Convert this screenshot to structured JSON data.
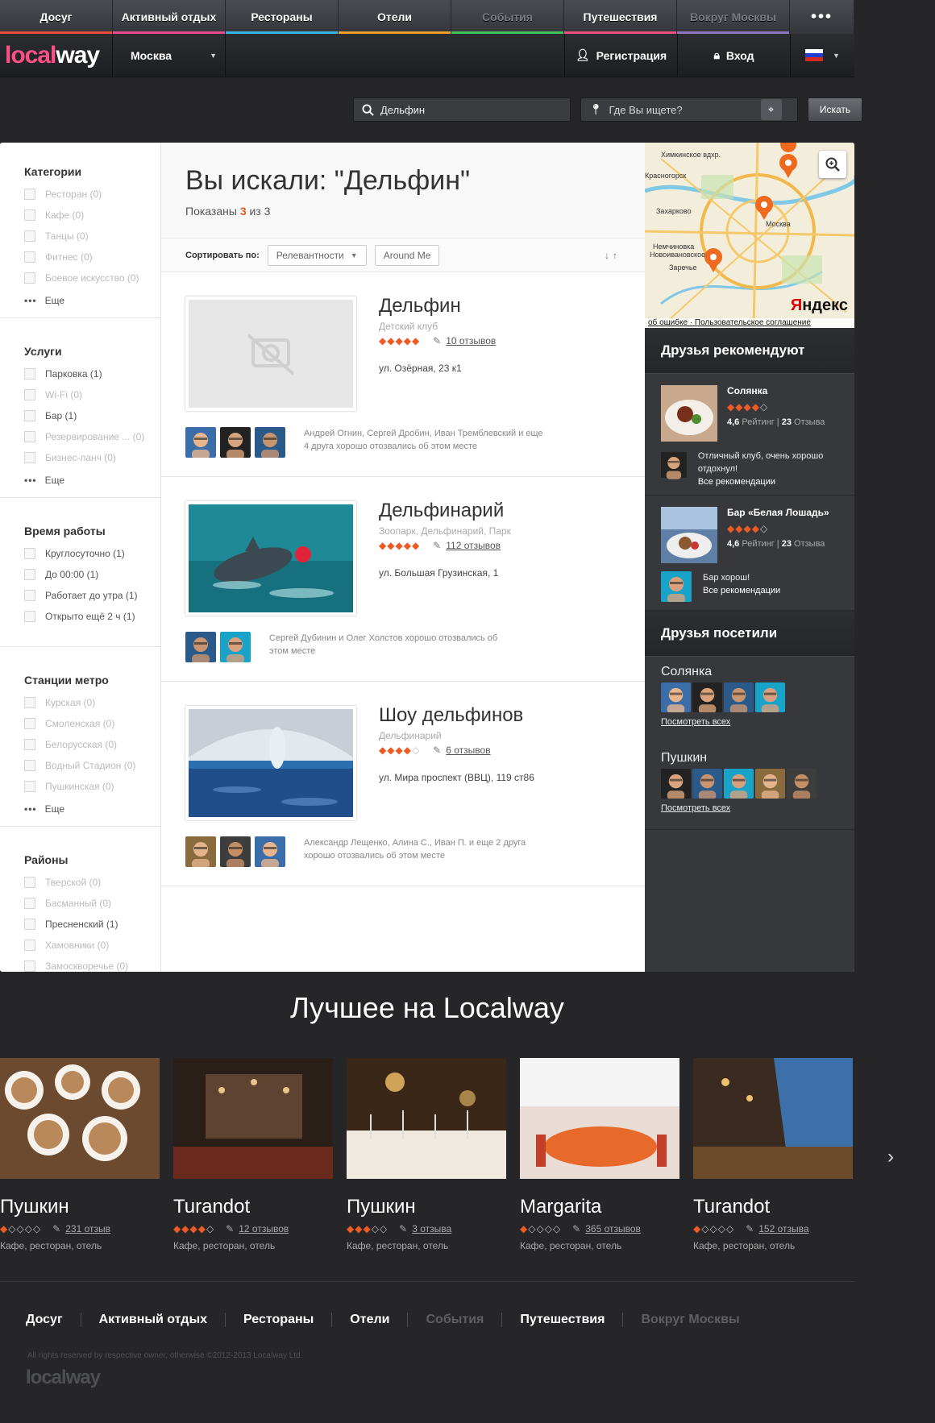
{
  "top_nav": [
    {
      "label": "Досуг",
      "color": "#e94b3c",
      "dim": false
    },
    {
      "label": "Активный отдых",
      "color": "#e84a8b",
      "dim": false
    },
    {
      "label": "Рестораны",
      "color": "#35b6e5",
      "dim": false
    },
    {
      "label": "Отели",
      "color": "#f2a02c",
      "dim": false
    },
    {
      "label": "События",
      "color": "#3cc35a",
      "dim": true
    },
    {
      "label": "Путешествия",
      "color": "#ef4f7f",
      "dim": false
    },
    {
      "label": "Вокруг Москвы",
      "color": "#8f74c4",
      "dim": true
    }
  ],
  "top_more": "•••",
  "logo": {
    "part1": "local",
    "part2": "way"
  },
  "city": "Москва",
  "register": "Регистрация",
  "login": "Вход",
  "search": {
    "query": "Дельфин",
    "where_placeholder": "Где Вы ищете?",
    "button": "Искать"
  },
  "filters": [
    {
      "title": "Категории",
      "items": [
        {
          "label": "Ресторан (0)",
          "on": false
        },
        {
          "label": "Кафе (0)",
          "on": false
        },
        {
          "label": "Танцы (0)",
          "on": false
        },
        {
          "label": "Фитнес (0)",
          "on": false
        },
        {
          "label": "Боевое искусство (0)",
          "on": false
        }
      ],
      "more": "Еще"
    },
    {
      "title": "Услуги",
      "items": [
        {
          "label": "Парковка (1)",
          "on": true
        },
        {
          "label": "Wi-Fi (0)",
          "on": false
        },
        {
          "label": "Бар (1)",
          "on": true
        },
        {
          "label": "Резервирование ... (0)",
          "on": false
        },
        {
          "label": "Бизнес-ланч (0)",
          "on": false
        }
      ],
      "more": "Еще"
    },
    {
      "title": "Время работы",
      "items": [
        {
          "label": "Круглосуточно (1)",
          "on": true
        },
        {
          "label": "До 00:00 (1)",
          "on": true
        },
        {
          "label": "Работает до утра (1)",
          "on": true
        },
        {
          "label": "Открыто ещё 2 ч (1)",
          "on": true
        }
      ],
      "more": ""
    },
    {
      "title": "Станции метро",
      "items": [
        {
          "label": "Курская (0)",
          "on": false
        },
        {
          "label": "Смоленская (0)",
          "on": false
        },
        {
          "label": "Белорусская (0)",
          "on": false
        },
        {
          "label": "Водный Стадион (0)",
          "on": false
        },
        {
          "label": "Пушкинская (0)",
          "on": false
        }
      ],
      "more": "Еще"
    },
    {
      "title": "Районы",
      "items": [
        {
          "label": "Тверской (0)",
          "on": false
        },
        {
          "label": "Басманный (0)",
          "on": false
        },
        {
          "label": "Пресненский (1)",
          "on": true
        },
        {
          "label": "Хамовники (0)",
          "on": false
        },
        {
          "label": "Замоскворечье (0)",
          "on": false
        }
      ],
      "more": "Еще"
    }
  ],
  "results": {
    "title": "Вы искали: \"Дельфин\"",
    "shown_prefix": "Показаны",
    "shown_count": "3",
    "shown_suffix": "из 3",
    "sort_label": "Сортировать по:",
    "sort_value": "Релевантности",
    "sort_around": "Around Me",
    "sort_arrows": "↓↑",
    "items": [
      {
        "name": "Дельфин",
        "category": "Детский клуб",
        "stars": 5,
        "reviews": "10 отзывов",
        "address": "ул. Озёрная, 23 к1",
        "friends": "Андрей Огнин, Сергей Дробин, Иван Тремблевский и еще 4 друга хорошо отозвались об этом месте",
        "avatars": 3
      },
      {
        "name": "Дельфинарий",
        "category": "Зоопарк, Дельфинарий, Парк",
        "stars": 5,
        "reviews": "112 отзывов",
        "address": "ул. Большая Грузинская, 1",
        "friends": "Сергей Дубинин и Олег Холстов хорошо отозвались об этом месте",
        "avatars": 2
      },
      {
        "name": "Шоу дельфинов",
        "category": "Дельфинарий",
        "stars": 4,
        "reviews": "6 отзывов",
        "address": "ул. Мира проспект (ВВЦ), 119 ст86",
        "friends": "Александр Лещенко, Алина С., Иван П. и еще 2 друга хорошо отозвались об этом месте",
        "avatars": 3
      }
    ]
  },
  "map": {
    "brand_a": "Я",
    "brand_b": "ндекс",
    "footer": "об ошибке · Пользовательское соглашение",
    "labels": [
      "Химкинское вдхр.",
      "Красногорск",
      "Захарково",
      "Москва",
      "Немчиновка",
      "Новоивановское",
      "Заречье"
    ]
  },
  "friends_recommend": {
    "title": "Друзья рекомендуют",
    "items": [
      {
        "name": "Солянка",
        "stars": 4,
        "rating": "4,6",
        "rating_label": "Рейтинг",
        "reviews": "23",
        "reviews_label": "Отзыва",
        "text": "Отличный клуб, очень хорошо отдохнул!",
        "link": "Все рекомендации"
      },
      {
        "name": "Бар «Белая Лошадь»",
        "stars": 4,
        "rating": "4,6",
        "rating_label": "Рейтинг",
        "reviews": "23",
        "reviews_label": "Отзыва",
        "text": "Бар хорош!",
        "link": "Все рекомендации"
      }
    ]
  },
  "friends_visited": {
    "title": "Друзья посетили",
    "places": [
      {
        "name": "Солянка",
        "count": 4,
        "link": "Посмотреть всех"
      },
      {
        "name": "Пушкин",
        "count": 5,
        "link": "Посмотреть всех"
      }
    ]
  },
  "best": {
    "title": "Лучшее на Localway",
    "cards": [
      {
        "name": "Пушкин",
        "stars": 1,
        "reviews": "231 отзыв",
        "category": "Кафе, ресторан, отель"
      },
      {
        "name": "Turandot",
        "stars": 4,
        "reviews": "12 отзывов",
        "category": "Кафе, ресторан, отель"
      },
      {
        "name": "Пушкин",
        "stars": 3,
        "reviews": "3 отзыва",
        "category": "Кафе, ресторан, отель"
      },
      {
        "name": "Margarita",
        "stars": 1,
        "reviews": "365 отзывов",
        "category": "Кафе, ресторан, отель"
      },
      {
        "name": "Turandot",
        "stars": 1,
        "reviews": "152 отзыва",
        "category": "Кафе, ресторан, отель"
      }
    ]
  },
  "footer": {
    "nav": [
      {
        "label": "Досуг",
        "dim": false
      },
      {
        "label": "Активный отдых",
        "dim": false
      },
      {
        "label": "Рестораны",
        "dim": false
      },
      {
        "label": "Отели",
        "dim": false
      },
      {
        "label": "События",
        "dim": true
      },
      {
        "label": "Путешествия",
        "dim": false
      },
      {
        "label": "Вокруг Москвы",
        "dim": true
      }
    ],
    "copyright": "All rights reserved by respective owner, otherwise ©2012-2013 Localway Ltd.",
    "logo": "localway"
  }
}
